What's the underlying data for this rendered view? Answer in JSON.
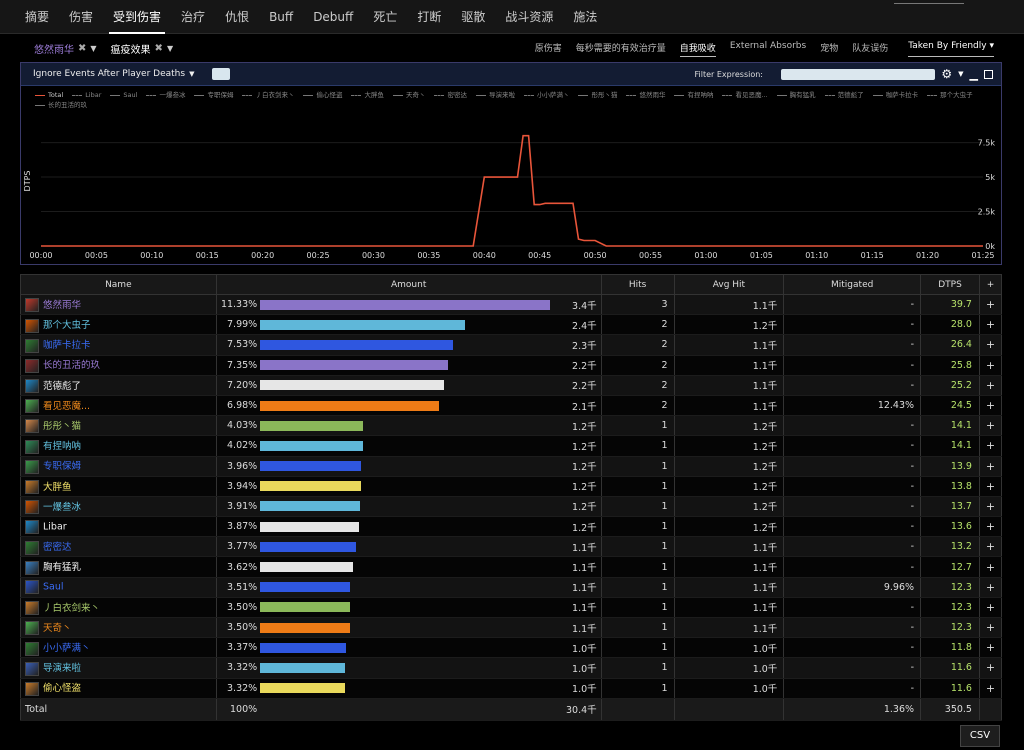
{
  "nav": {
    "tabs": [
      "摘要",
      "伤害",
      "受到伤害",
      "治疗",
      "仇恨",
      "Buff",
      "Debuff",
      "死亡",
      "打断",
      "驱散",
      "战斗资源",
      "施法"
    ],
    "active": 2
  },
  "filters": {
    "player": "悠然雨华",
    "ability": "瘟疫效果",
    "options": [
      "原伤害",
      "每秒需要的有效治疗量",
      "自我吸收",
      "External Absorbs",
      "宠物",
      "队友误伤"
    ],
    "active_option": "自我吸收",
    "taken_by": "Taken By Friendly"
  },
  "chart_panel": {
    "ignore_label": "Ignore Events After Player Deaths",
    "filter_label": "Filter Expression:",
    "filter_value": "",
    "legend": [
      "Total",
      "Libar",
      "Saul",
      "一爆叁冰",
      "专职保姆",
      "丿白衣剑来丶",
      "偷心怪盗",
      "大胖鱼",
      "天奇丶",
      "密密达",
      "导演来啦",
      "小小萨满丶",
      "彤彤丶猫",
      "悠然雨华",
      "有捏呐呐",
      "看见恶魔...",
      "胸有猛乳",
      "范德彪了",
      "咖萨卡拉卡",
      "那个大虫子",
      "长的丑活的玖"
    ]
  },
  "chart_data": {
    "type": "line",
    "ylabel": "DTPS",
    "x_ticks": [
      "00:00",
      "00:05",
      "00:10",
      "00:15",
      "00:20",
      "00:25",
      "00:30",
      "00:35",
      "00:40",
      "00:45",
      "00:50",
      "00:55",
      "01:00",
      "01:05",
      "01:10",
      "01:15",
      "01:20",
      "01:25"
    ],
    "y_ticks": [
      "0k",
      "2.5k",
      "5k",
      "7.5k"
    ],
    "ylim": [
      0,
      9500
    ],
    "xlim": [
      0,
      85
    ],
    "series": [
      {
        "name": "Total",
        "color": "#e8553a",
        "x": [
          0,
          39,
          40,
          42,
          43,
          43.5,
          44,
          44.5,
          45,
          45.5,
          48,
          48.5,
          49,
          50,
          51,
          85
        ],
        "y": [
          0,
          0,
          5000,
          5000,
          5000,
          8000,
          8000,
          3000,
          3000,
          3100,
          3100,
          500,
          400,
          400,
          0,
          0
        ]
      }
    ]
  },
  "table": {
    "headers": [
      "Name",
      "Amount",
      "Hits",
      "Avg Hit",
      "Mitigated",
      "DTPS",
      "+"
    ],
    "rows": [
      {
        "name": "悠然雨华",
        "color": "#9b7bd6",
        "icon_color": "#c0392b",
        "pct": "11.33%",
        "pct_val": 11.33,
        "bar_color": "#8a74c8",
        "amount": "3.4千",
        "hits": "3",
        "avg": "1.1千",
        "mit": "-",
        "dtps": "39.7"
      },
      {
        "name": "那个大虫子",
        "color": "#62c0de",
        "icon_color": "#d35400",
        "pct": "7.99%",
        "pct_val": 7.99,
        "bar_color": "#5fb7d9",
        "amount": "2.4千",
        "hits": "2",
        "avg": "1.2千",
        "mit": "-",
        "dtps": "28.0"
      },
      {
        "name": "咖萨卡拉卡",
        "color": "#3a6cf5",
        "icon_color": "#2e7d32",
        "pct": "7.53%",
        "pct_val": 7.53,
        "bar_color": "#2f57e0",
        "amount": "2.3千",
        "hits": "2",
        "avg": "1.1千",
        "mit": "-",
        "dtps": "26.4"
      },
      {
        "name": "长的丑活的玖",
        "color": "#9b7bd6",
        "icon_color": "#8e2b2b",
        "pct": "7.35%",
        "pct_val": 7.35,
        "bar_color": "#8a74c8",
        "amount": "2.2千",
        "hits": "2",
        "avg": "1.1千",
        "mit": "-",
        "dtps": "25.8"
      },
      {
        "name": "范德彪了",
        "color": "#eeeeee",
        "icon_color": "#1e88c8",
        "pct": "7.20%",
        "pct_val": 7.2,
        "bar_color": "#e6e6e6",
        "amount": "2.2千",
        "hits": "2",
        "avg": "1.1千",
        "mit": "-",
        "dtps": "25.2"
      },
      {
        "name": "看见恶魔...",
        "color": "#f08a1c",
        "icon_color": "#4caf50",
        "pct": "6.98%",
        "pct_val": 6.98,
        "bar_color": "#ee7b16",
        "amount": "2.1千",
        "hits": "2",
        "avg": "1.1千",
        "mit": "12.43%",
        "dtps": "24.5"
      },
      {
        "name": "彤彤丶猫",
        "color": "#a8c96b",
        "icon_color": "#d4884a",
        "pct": "4.03%",
        "pct_val": 4.03,
        "bar_color": "#8bb85a",
        "amount": "1.2千",
        "hits": "1",
        "avg": "1.2千",
        "mit": "-",
        "dtps": "14.1"
      },
      {
        "name": "有捏呐呐",
        "color": "#62c0de",
        "icon_color": "#2e8b57",
        "pct": "4.02%",
        "pct_val": 4.02,
        "bar_color": "#5fb7d9",
        "amount": "1.2千",
        "hits": "1",
        "avg": "1.2千",
        "mit": "-",
        "dtps": "14.1"
      },
      {
        "name": "专职保姆",
        "color": "#3a6cf5",
        "icon_color": "#3a9b4a",
        "pct": "3.96%",
        "pct_val": 3.96,
        "bar_color": "#2f57e0",
        "amount": "1.2千",
        "hits": "1",
        "avg": "1.2千",
        "mit": "-",
        "dtps": "13.9"
      },
      {
        "name": "大胖鱼",
        "color": "#f0e06a",
        "icon_color": "#c97b2a",
        "pct": "3.94%",
        "pct_val": 3.94,
        "bar_color": "#e9d95c",
        "amount": "1.2千",
        "hits": "1",
        "avg": "1.2千",
        "mit": "-",
        "dtps": "13.8"
      },
      {
        "name": "一爆叁冰",
        "color": "#62c0de",
        "icon_color": "#d35400",
        "pct": "3.91%",
        "pct_val": 3.91,
        "bar_color": "#5fb7d9",
        "amount": "1.2千",
        "hits": "1",
        "avg": "1.2千",
        "mit": "-",
        "dtps": "13.7"
      },
      {
        "name": "Libar",
        "color": "#eeeeee",
        "icon_color": "#1e88c8",
        "pct": "3.87%",
        "pct_val": 3.87,
        "bar_color": "#e6e6e6",
        "amount": "1.2千",
        "hits": "1",
        "avg": "1.2千",
        "mit": "-",
        "dtps": "13.6"
      },
      {
        "name": "密密达",
        "color": "#3a6cf5",
        "icon_color": "#2e7d32",
        "pct": "3.77%",
        "pct_val": 3.77,
        "bar_color": "#2f57e0",
        "amount": "1.1千",
        "hits": "1",
        "avg": "1.1千",
        "mit": "-",
        "dtps": "13.2"
      },
      {
        "name": "胸有猛乳",
        "color": "#eeeeee",
        "icon_color": "#3a7fc0",
        "pct": "3.62%",
        "pct_val": 3.62,
        "bar_color": "#e6e6e6",
        "amount": "1.1千",
        "hits": "1",
        "avg": "1.1千",
        "mit": "-",
        "dtps": "12.7"
      },
      {
        "name": "Saul",
        "color": "#3a6cf5",
        "icon_color": "#2b55c9",
        "pct": "3.51%",
        "pct_val": 3.51,
        "bar_color": "#2f57e0",
        "amount": "1.1千",
        "hits": "1",
        "avg": "1.1千",
        "mit": "9.96%",
        "dtps": "12.3"
      },
      {
        "name": "丿白衣剑来丶",
        "color": "#a8c96b",
        "icon_color": "#c97b2a",
        "pct": "3.50%",
        "pct_val": 3.5,
        "bar_color": "#8bb85a",
        "amount": "1.1千",
        "hits": "1",
        "avg": "1.1千",
        "mit": "-",
        "dtps": "12.3"
      },
      {
        "name": "天奇丶",
        "color": "#f08a1c",
        "icon_color": "#4caf50",
        "pct": "3.50%",
        "pct_val": 3.5,
        "bar_color": "#ee7b16",
        "amount": "1.1千",
        "hits": "1",
        "avg": "1.1千",
        "mit": "-",
        "dtps": "12.3"
      },
      {
        "name": "小小萨满丶",
        "color": "#3a6cf5",
        "icon_color": "#2e7d32",
        "pct": "3.37%",
        "pct_val": 3.37,
        "bar_color": "#2f57e0",
        "amount": "1.0千",
        "hits": "1",
        "avg": "1.0千",
        "mit": "-",
        "dtps": "11.8"
      },
      {
        "name": "导演来啦",
        "color": "#62c0de",
        "icon_color": "#3a5fb8",
        "pct": "3.32%",
        "pct_val": 3.32,
        "bar_color": "#5fb7d9",
        "amount": "1.0千",
        "hits": "1",
        "avg": "1.0千",
        "mit": "-",
        "dtps": "11.6"
      },
      {
        "name": "偷心怪盗",
        "color": "#f0e06a",
        "icon_color": "#c97b2a",
        "pct": "3.32%",
        "pct_val": 3.32,
        "bar_color": "#e9d95c",
        "amount": "1.0千",
        "hits": "1",
        "avg": "1.0千",
        "mit": "-",
        "dtps": "11.6"
      }
    ],
    "total": {
      "label": "Total",
      "pct": "100%",
      "amount": "30.4千",
      "mit": "1.36%",
      "dtps": "350.5"
    }
  },
  "csv_label": "CSV"
}
